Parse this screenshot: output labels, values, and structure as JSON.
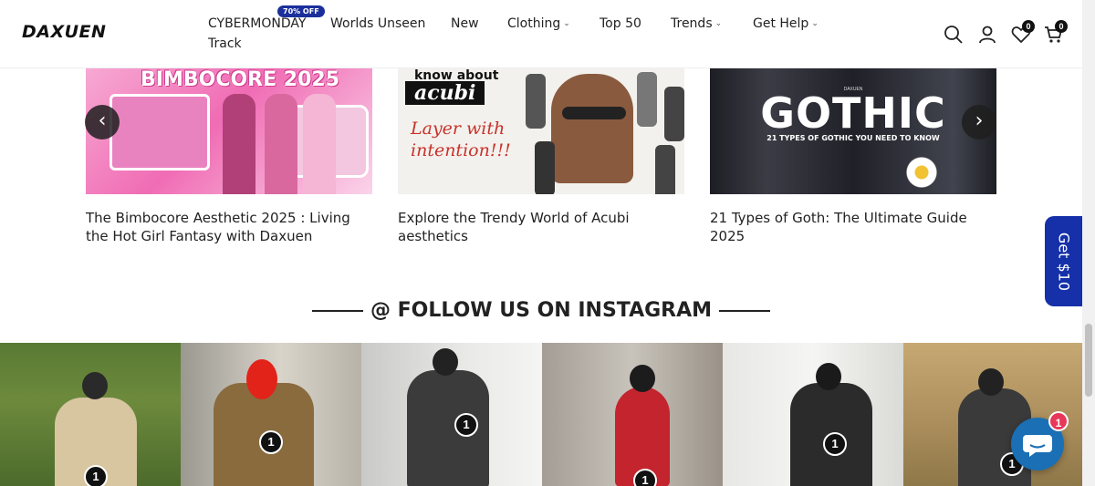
{
  "header": {
    "logo": "DAXUEN",
    "badge": "70% OFF",
    "nav": [
      {
        "label": "CYBERMONDAY",
        "dropdown": false
      },
      {
        "label": "Worlds Unseen",
        "dropdown": false
      },
      {
        "label": "New",
        "dropdown": false
      },
      {
        "label": "Clothing",
        "dropdown": true
      },
      {
        "label": "Top 50",
        "dropdown": false
      },
      {
        "label": "Trends",
        "dropdown": true
      },
      {
        "label": "Get Help",
        "dropdown": true
      },
      {
        "label": "Track",
        "dropdown": false
      }
    ],
    "wishlist_count": "0",
    "cart_count": "0"
  },
  "blog": {
    "prev_arrow": "‹",
    "next_arrow": "›",
    "posts": [
      {
        "title": "The Bimbocore Aesthetic 2025 : Living the Hot Girl Fantasy with Daxuen",
        "image_text": "BIMBOCORE 2025"
      },
      {
        "title": "Explore the Trendy World of Acubi aesthetics",
        "image_text": [
          "know about",
          "acubi",
          "Layer with",
          "intention!!!"
        ]
      },
      {
        "title": "21 Types of Goth: The Ultimate Guide 2025",
        "image_text": [
          "DAXUEN",
          "GOTHIC",
          "21 TYPES OF GOTHIC YOU NEED TO KNOW"
        ]
      }
    ]
  },
  "promo": {
    "label": "Get $10",
    "color": "#1530a8"
  },
  "instagram": {
    "heading": "@ FOLLOW US ON INSTAGRAM",
    "tiles": [
      {
        "pin": "1"
      },
      {
        "pin": "1"
      },
      {
        "pin": "1"
      },
      {
        "pin": "1"
      },
      {
        "pin": "1"
      },
      {
        "pin": "1"
      }
    ]
  },
  "chat": {
    "badge": "1",
    "color": "#1a6fb5"
  },
  "colors": {
    "accent": "#1b2f9c",
    "text": "#222222"
  }
}
